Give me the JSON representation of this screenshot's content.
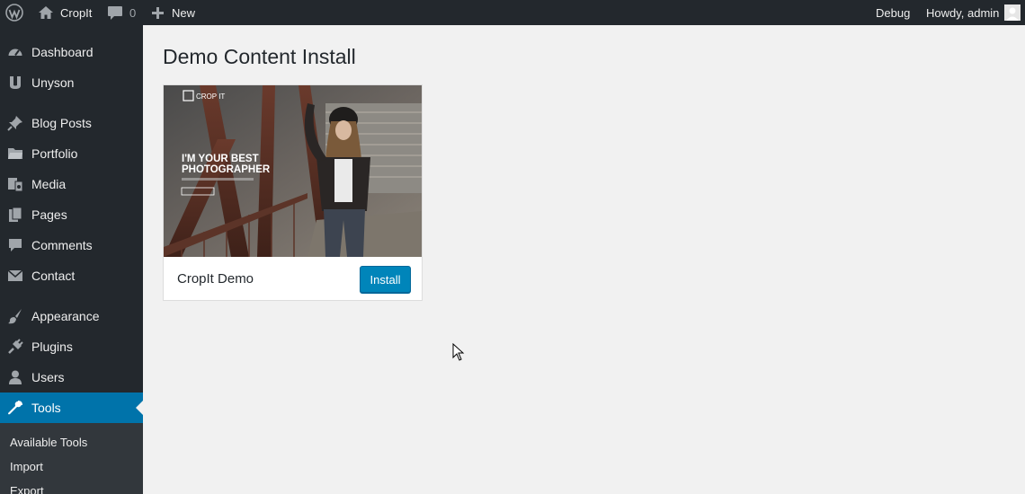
{
  "adminbar": {
    "site_name": "CropIt",
    "comments_count": "0",
    "new_label": "New",
    "debug_label": "Debug",
    "greeting": "Howdy, admin"
  },
  "sidebar": {
    "items": [
      {
        "label": "Dashboard",
        "icon": "dashboard-icon"
      },
      {
        "label": "Unyson",
        "icon": "unyson-icon"
      },
      {
        "label": "Blog Posts",
        "icon": "pin-icon"
      },
      {
        "label": "Portfolio",
        "icon": "folder-icon"
      },
      {
        "label": "Media",
        "icon": "media-icon"
      },
      {
        "label": "Pages",
        "icon": "pages-icon"
      },
      {
        "label": "Comments",
        "icon": "comment-icon"
      },
      {
        "label": "Contact",
        "icon": "mail-icon"
      },
      {
        "label": "Appearance",
        "icon": "brush-icon"
      },
      {
        "label": "Plugins",
        "icon": "plugin-icon"
      },
      {
        "label": "Users",
        "icon": "user-icon"
      },
      {
        "label": "Tools",
        "icon": "wrench-icon"
      }
    ],
    "current": "Tools",
    "submenu": [
      "Available Tools",
      "Import",
      "Export"
    ]
  },
  "main": {
    "title": "Demo Content Install",
    "demo": {
      "name": "CropIt Demo",
      "install_label": "Install",
      "thumbnail": {
        "logo_text": "CROP IT",
        "headline_line1": "I'M YOUR BEST",
        "headline_line2": "PHOTOGRAPHER"
      }
    }
  },
  "colors": {
    "adminbar_bg": "#23282d",
    "sidebar_bg": "#23282d",
    "submenu_bg": "#32373c",
    "current_bg": "#0073aa",
    "button_bg": "#0085ba",
    "page_bg": "#f1f1f1"
  }
}
